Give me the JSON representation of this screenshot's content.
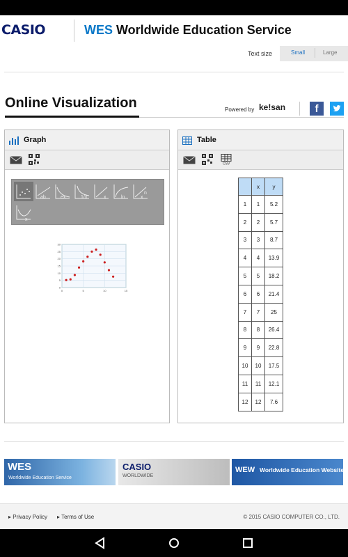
{
  "header": {
    "brand": "CASIO",
    "wes": "WES",
    "title": "Worldwide Education Service"
  },
  "text_size": {
    "label": "Text size",
    "options": [
      "Small",
      "Large"
    ],
    "selected": "Small"
  },
  "page": {
    "title": "Online Visualization",
    "powered_by": "Powered by",
    "powered_brand": "ke!san"
  },
  "graph_panel": {
    "title": "Graph",
    "graph_type_icons": [
      "scatter-icon",
      "linear-regression-icon",
      "exponential-regression-icon",
      "inverse-regression-icon",
      "power-regression-icon",
      "logarithmic-regression-icon",
      "power-n-regression-icon",
      "quadratic-regression-icon"
    ],
    "chart_data": {
      "type": "scatter",
      "x": [
        1,
        2,
        3,
        4,
        5,
        6,
        7,
        8,
        9,
        10,
        11,
        12
      ],
      "y": [
        5.2,
        5.7,
        8.7,
        13.9,
        18.2,
        21.4,
        25,
        26.4,
        22.8,
        17.5,
        12.1,
        7.6
      ],
      "xlim": [
        0,
        15
      ],
      "ylim": [
        0,
        30
      ],
      "x_ticks": [
        "0",
        "5",
        "10",
        "15"
      ],
      "y_ticks": [
        "0",
        "5",
        "10",
        "15",
        "20",
        "25",
        "30"
      ],
      "grid": true,
      "point_color": "#cc1f1f"
    }
  },
  "table_panel": {
    "title": "Table",
    "columns": [
      "",
      "x",
      "y"
    ],
    "rows": [
      [
        "1",
        "1",
        "5.2"
      ],
      [
        "2",
        "2",
        "5.7"
      ],
      [
        "3",
        "3",
        "8.7"
      ],
      [
        "4",
        "4",
        "13.9"
      ],
      [
        "5",
        "5",
        "18.2"
      ],
      [
        "6",
        "6",
        "21.4"
      ],
      [
        "7",
        "7",
        "25"
      ],
      [
        "8",
        "8",
        "26.4"
      ],
      [
        "9",
        "9",
        "22.8"
      ],
      [
        "10",
        "10",
        "17.5"
      ],
      [
        "11",
        "11",
        "12.1"
      ],
      [
        "12",
        "12",
        "7.6"
      ]
    ]
  },
  "banners": {
    "wes_title": "WES",
    "wes_sub": "Worldwide Education Service",
    "casio_title": "CASIO",
    "casio_sub": "WORLDWIDE",
    "wew_title": "WEW",
    "wew_sub": "Worldwide Education Website"
  },
  "footer": {
    "privacy": "Privacy Policy",
    "terms": "Terms of Use",
    "copyright": "© 2015 CASIO COMPUTER CO., LTD."
  },
  "colors": {
    "accent": "#0a78c8",
    "table_header": "#bfdcf6",
    "facebook": "#3b5998",
    "twitter": "#1da1f2"
  }
}
